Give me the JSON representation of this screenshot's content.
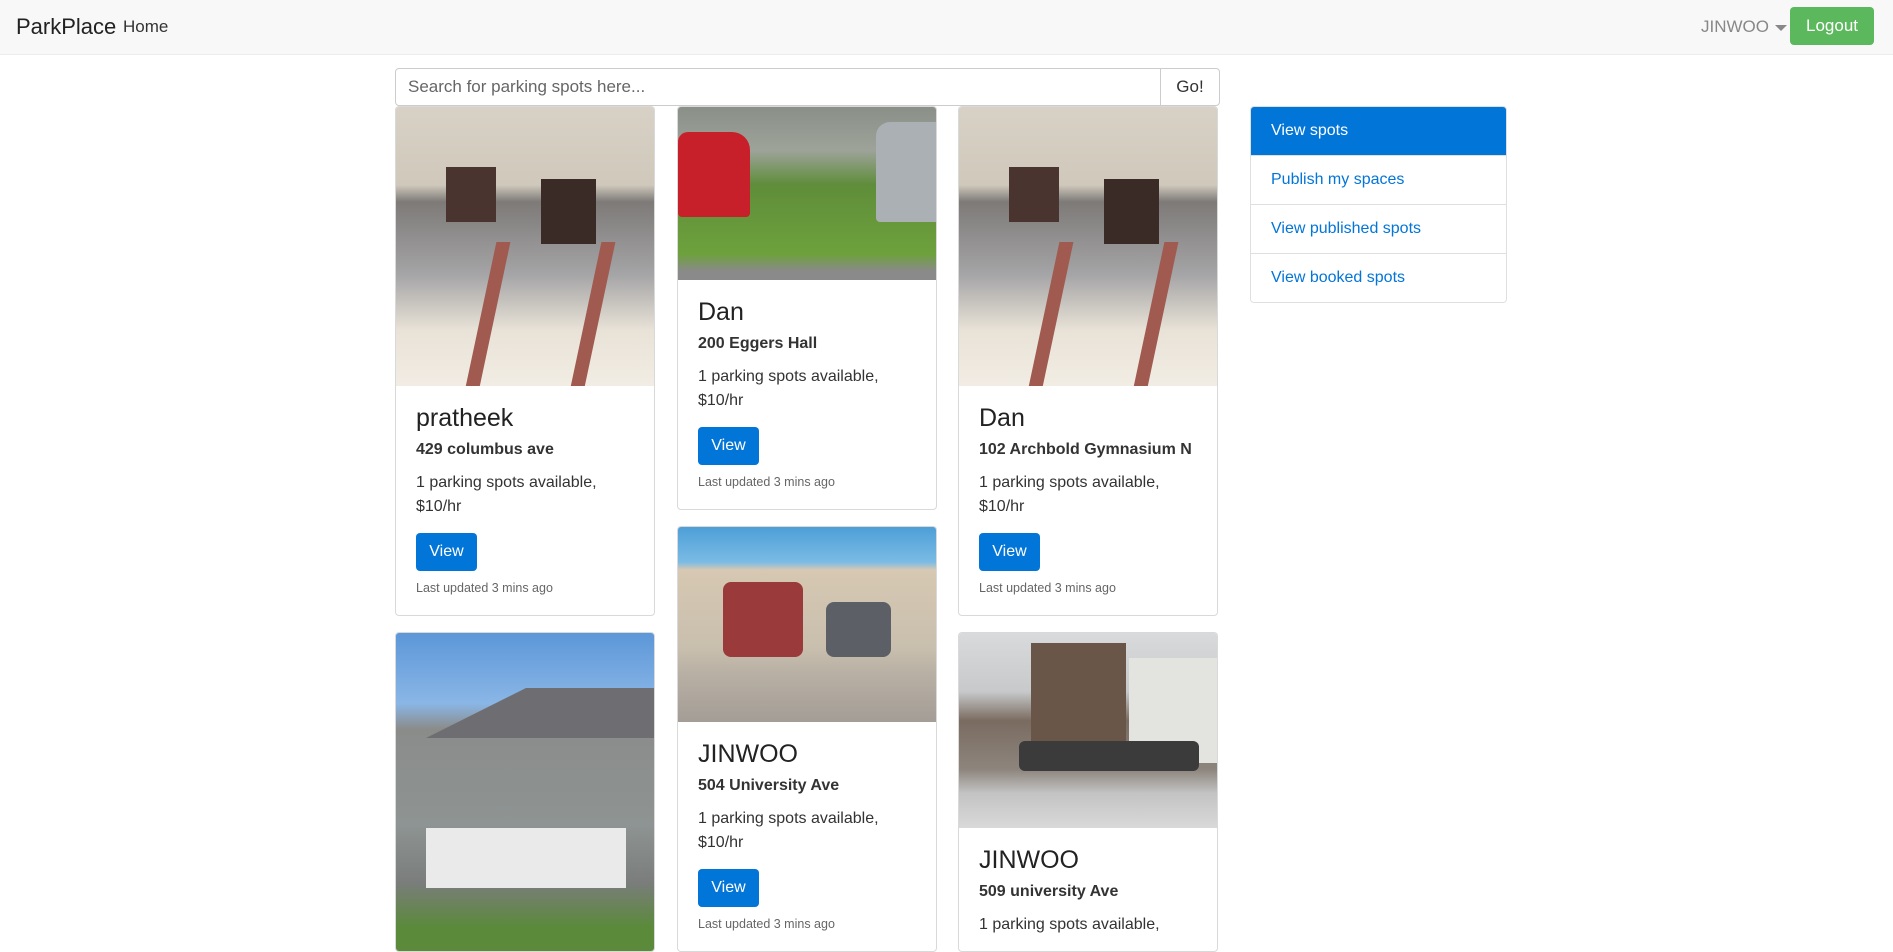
{
  "navbar": {
    "brand": "ParkPlace",
    "home": "Home",
    "user": "JINWOO",
    "logout": "Logout"
  },
  "search": {
    "placeholder": "Search for parking spots here...",
    "go_label": "Go!"
  },
  "cards": [
    {
      "name": "pratheek",
      "address": "429 columbus ave",
      "availability": "1 parking spots available, $10/hr",
      "view_label": "View",
      "updated": "Last updated 3 mins ago"
    },
    {
      "name": "Dan",
      "address": "200 Eggers Hall",
      "availability": "1 parking spots available, $10/hr",
      "view_label": "View",
      "updated": "Last updated 3 mins ago"
    },
    {
      "name": "Dan",
      "address": "102 Archbold Gymnasium N",
      "availability": "1 parking spots available, $10/hr",
      "view_label": "View",
      "updated": "Last updated 3 mins ago"
    },
    {
      "name": "JINWOO",
      "address": "504 University Ave",
      "availability": "1 parking spots available, $10/hr",
      "view_label": "View",
      "updated": "Last updated 3 mins ago"
    },
    {
      "name": "JINWOO",
      "address": "509 university Ave",
      "availability": "1 parking spots available,"
    }
  ],
  "sidebar": {
    "items": [
      {
        "label": "View spots"
      },
      {
        "label": "Publish my spaces"
      },
      {
        "label": "View published spots"
      },
      {
        "label": "View booked spots"
      }
    ]
  }
}
